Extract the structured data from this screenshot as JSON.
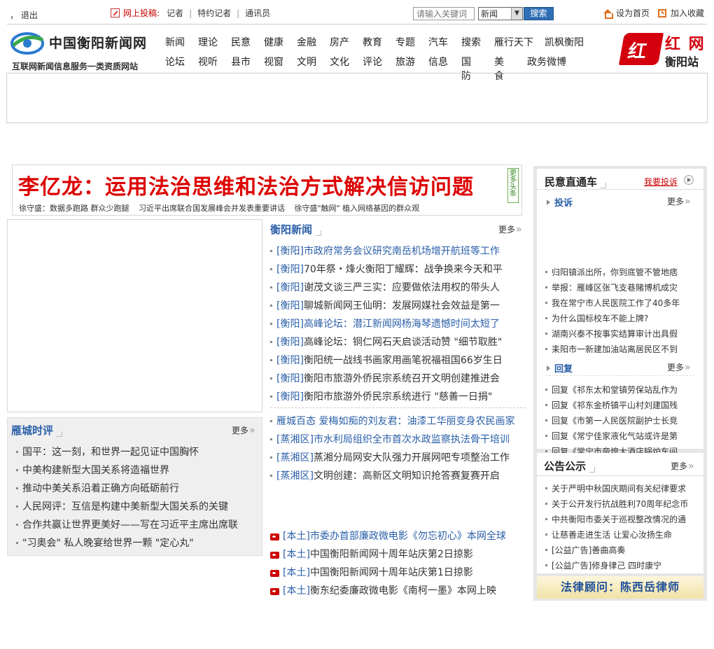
{
  "topbar": {
    "logout": "， 退出",
    "tougao_label": "网上投稿:",
    "tougao_links": [
      "记者",
      "特约记者",
      "通讯员"
    ],
    "search_placeholder": "请输入关键词",
    "search_select_value": "新闻",
    "search_button": "搜索",
    "set_home": "设为首页",
    "add_favorite": "加入收藏"
  },
  "header": {
    "logo_name": "中国衡阳新闻网",
    "logo_slogan": "互联网新闻信息服务一类资质网站",
    "nav_row_1": [
      "新闻",
      "理论",
      "民意",
      "健康",
      "金融",
      "房产",
      "教育",
      "专题",
      "汽车",
      "搜索",
      "雁行天下",
      "凯枫衡阳"
    ],
    "nav_row_2": [
      "论坛",
      "视听",
      "县市",
      "视窗",
      "文明",
      "文化",
      "评论",
      "旅游",
      "信息",
      "国防",
      "美食",
      "政务微博"
    ],
    "hongwang_mark": "红",
    "hongwang_name": "红 网",
    "hongwang_sub": "衡阳站"
  },
  "headline": {
    "title": "李亿龙：运用法治思维和法治方式解决信访问题",
    "subs": [
      "徐守盛：数据多跑路 群众少跑腿",
      "习近平出席联合国发展峰会并发表重要讲话",
      "徐守盛\"触网\" 植入网络基因的群众观"
    ],
    "more_label": "更多头条"
  },
  "shiping": {
    "title": "雁城时评",
    "more": "更多",
    "items": [
      "国平：这一刻，和世界一起见证中国胸怀",
      "中美构建新型大国关系将造福世界",
      "推动中美关系沿着正确方向砥砺前行",
      "人民网评：互信是构建中美新型大国关系的关键",
      "合作共赢让世界更美好——写在习近平主席出席联",
      "\"习奥会\" 私人晚宴给世界一颗 \"定心丸\""
    ]
  },
  "hy_news": {
    "title": "衡阳新闻",
    "more": "更多",
    "items": [
      {
        "tag": "[衡阳]",
        "text": "市政府常务会议研究南岳机场增开航班等工作",
        "highlight": true
      },
      {
        "tag": "[衡阳]",
        "text": "70年祭・烽火衡阳丁耀辉：战争换来今天和平",
        "highlight": false
      },
      {
        "tag": "[衡阳]",
        "text": "谢茂文谈三严三实：应要做依法用权的带头人",
        "highlight": false
      },
      {
        "tag": "[衡阳]",
        "text": "聊城新闻网王仙明：发展网媒社会效益是第一",
        "highlight": false
      },
      {
        "tag": "[衡阳]",
        "text": "高峰论坛：潜江新闻网杨海琴遗憾时间太短了",
        "highlight": true
      },
      {
        "tag": "[衡阳]",
        "text": "高峰论坛：铜仁网石天启谈活动赞 \"细节取胜\"",
        "highlight": false
      },
      {
        "tag": "[衡阳]",
        "text": "衡阳统一战线书画家用画笔祝福祖国66岁生日",
        "highlight": false
      },
      {
        "tag": "[衡阳]",
        "text": "衡阳市旅游外侨民宗系统召开文明创建推进会",
        "highlight": false
      },
      {
        "tag": "[衡阳]",
        "text": "衡阳市旅游外侨民宗系统进行 \"慈善一日捐\"",
        "highlight": false
      }
    ]
  },
  "county_news": {
    "items": [
      {
        "tag": "",
        "text": "雁城百态 爱梅如痴的刘友君：油漆工华丽变身农民画家",
        "highlight": true
      },
      {
        "tag": "[蒸湘区]",
        "text": "市水利局组织全市首次水政监察执法骨干培训",
        "highlight": true
      },
      {
        "tag": "[蒸湘区]",
        "text": "蒸湘分局网安大队强力开展网吧专项整治工作",
        "highlight": false
      },
      {
        "tag": "[蒸湘区]",
        "text": "文明创建：高新区文明知识抢答赛复赛开启",
        "highlight": false
      }
    ]
  },
  "local_video": {
    "items": [
      {
        "tag": "[本土]",
        "text": "市委办首部廉政微电影《勿忘初心》本网全球",
        "highlight": true
      },
      {
        "tag": "[本土]",
        "text": "中国衡阳新闻网十周年站庆第2日掠影",
        "highlight": false
      },
      {
        "tag": "[本土]",
        "text": "中国衡阳新闻网十周年站庆第1日掠影",
        "highlight": false
      },
      {
        "tag": "[本土]",
        "text": "衡东纪委廉政微电影《南柯一墨》本网上映",
        "highlight": false
      }
    ]
  },
  "minyi": {
    "title": "民意直通车",
    "complain_link": "我要投诉",
    "tousu_label": "投诉",
    "tousu_more": "更多",
    "tousu_items": [
      "归阳镇派出所，你到底管不管地痞",
      "举报：雁峰区张飞支巷赌博机成灾",
      "我在常宁市人民医院工作了40多年",
      "为什么国标校车不能上牌?",
      "湖南兴泰不按事实结算审计出具假",
      "耒阳市一新建加油站离居民区不到"
    ],
    "huifu_label": "回复",
    "huifu_more": "更多",
    "huifu_items": [
      "回复《祁东太和堂镇劳保站乱作为",
      "回复《祁东金桥镇平山村刘建国残",
      "回复《市第一人民医院副护士长竞",
      "回复《常宁佳家液化气站或许是第",
      "回复《常宁市帝煌大酒店锅炉车间"
    ]
  },
  "gonggao": {
    "title": "公告公示",
    "more": "更多",
    "items": [
      "关于严明中秋国庆期间有关纪律要求",
      "关于公开发行抗战胜利70周年纪念币",
      "中共衡阳市委关于巡视整改情况的通",
      "让慈善走进生活 让爱心汝扬生命",
      "[公益广告]善曲高奏",
      "[公益广告]修身律己 四时康宁"
    ]
  },
  "lawyer_banner": "法律顾问：陈西岳律师"
}
